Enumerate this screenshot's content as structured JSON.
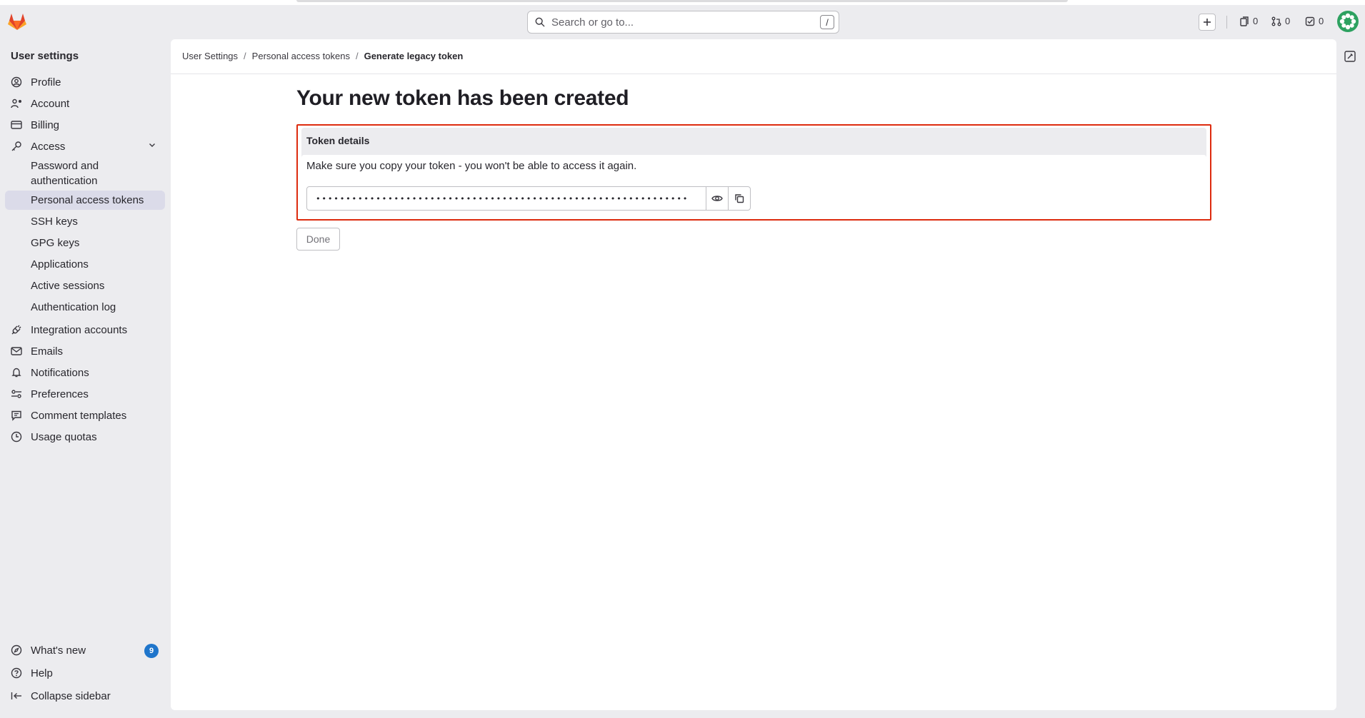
{
  "search": {
    "placeholder": "Search or go to...",
    "shortcut": "/"
  },
  "counters": {
    "issues": "0",
    "merge_requests": "0",
    "todos": "0"
  },
  "sidebar": {
    "title": "User settings",
    "items": [
      {
        "label": "Profile"
      },
      {
        "label": "Account"
      },
      {
        "label": "Billing"
      },
      {
        "label": "Access"
      },
      {
        "label": "Integration accounts"
      },
      {
        "label": "Emails"
      },
      {
        "label": "Notifications"
      },
      {
        "label": "Preferences"
      },
      {
        "label": "Comment templates"
      },
      {
        "label": "Usage quotas"
      }
    ],
    "access_sub": [
      {
        "label": "Password and"
      },
      {
        "label": "authentication"
      },
      {
        "label": "Personal access tokens"
      },
      {
        "label": "SSH keys"
      },
      {
        "label": "GPG keys"
      },
      {
        "label": "Applications"
      },
      {
        "label": "Active sessions"
      },
      {
        "label": "Authentication log"
      }
    ],
    "bottom": {
      "whats_new": "What's new",
      "whats_new_count": "9",
      "help": "Help",
      "collapse": "Collapse sidebar"
    }
  },
  "breadcrumb": {
    "items": [
      "User Settings",
      "Personal access tokens",
      "Generate legacy token"
    ],
    "separator": "/"
  },
  "page": {
    "title": "Your new token has been created",
    "token_heading": "Token details",
    "token_message": "Make sure you copy your token - you won't be able to access it again.",
    "token_value": "••••••••••••••••••••••••••••••••••••••••••••••••••••••••••••••",
    "done_label": "Done"
  },
  "colors": {
    "accent": "#1f75cb",
    "highlight_border": "#dd2b0e",
    "active_item": "#dbdbe9"
  }
}
